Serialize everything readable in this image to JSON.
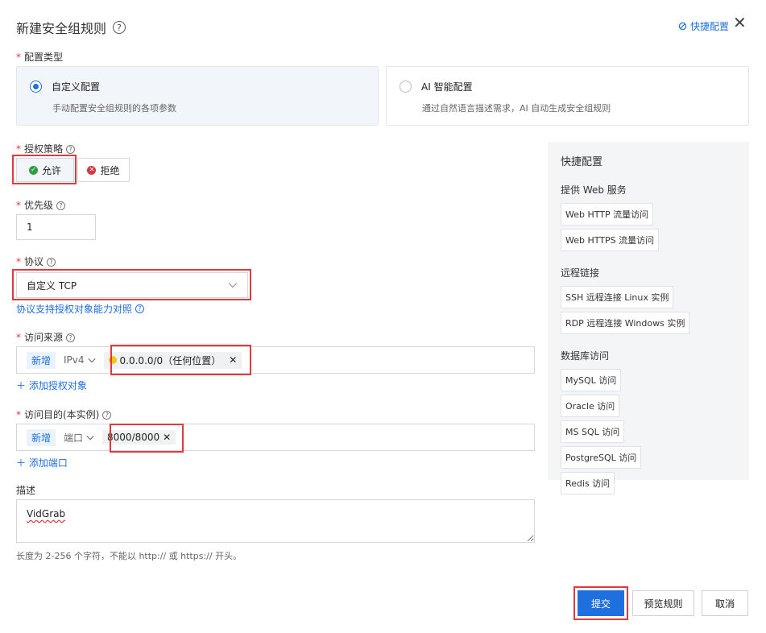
{
  "header": {
    "title": "新建安全组规则",
    "quick_config_link": "快捷配置"
  },
  "config_type": {
    "label": "配置类型",
    "options": [
      {
        "title": "自定义配置",
        "desc": "手动配置安全组规则的各项参数",
        "selected": true
      },
      {
        "title": "AI 智能配置",
        "desc": "通过自然语言描述需求，AI 自动生成安全组规则",
        "selected": false
      }
    ]
  },
  "policy": {
    "label": "授权策略",
    "allow_label": "允许",
    "deny_label": "拒绝",
    "selected": "允许"
  },
  "priority": {
    "label": "优先级",
    "value": "1"
  },
  "protocol": {
    "label": "协议",
    "value": "自定义 TCP",
    "support_link": "协议支持授权对象能力对照"
  },
  "source": {
    "label": "访问来源",
    "new_tag": "新增",
    "type": "IPv4",
    "chip": "0.0.0.0/0（任何位置）",
    "add_link": "添加授权对象"
  },
  "destination": {
    "label": "访问目的(本实例)",
    "new_tag": "新增",
    "type": "端口",
    "chip": "8000/8000",
    "add_link": "添加端口"
  },
  "description": {
    "label": "描述",
    "value": "VidGrab",
    "hint": "长度为 2-256 个字符，不能以 http:// 或 https:// 开头。"
  },
  "quick_panel": {
    "title": "快捷配置",
    "groups": [
      {
        "name": "提供 Web 服务",
        "items": [
          "Web HTTP 流量访问",
          "Web HTTPS 流量访问"
        ]
      },
      {
        "name": "远程链接",
        "items": [
          "SSH 远程连接 Linux 实例",
          "RDP 远程连接 Windows 实例"
        ]
      },
      {
        "name": "数据库访问",
        "items": [
          "MySQL 访问",
          "Oracle 访问",
          "MS SQL 访问",
          "PostgreSQL 访问",
          "Redis 访问"
        ]
      }
    ]
  },
  "footer": {
    "submit": "提交",
    "preview": "预览规则",
    "cancel": "取消"
  },
  "colors": {
    "accent": "#1f6fde",
    "highlight": "#e4393c",
    "allow": "#2ea043",
    "deny": "#d9363e"
  }
}
